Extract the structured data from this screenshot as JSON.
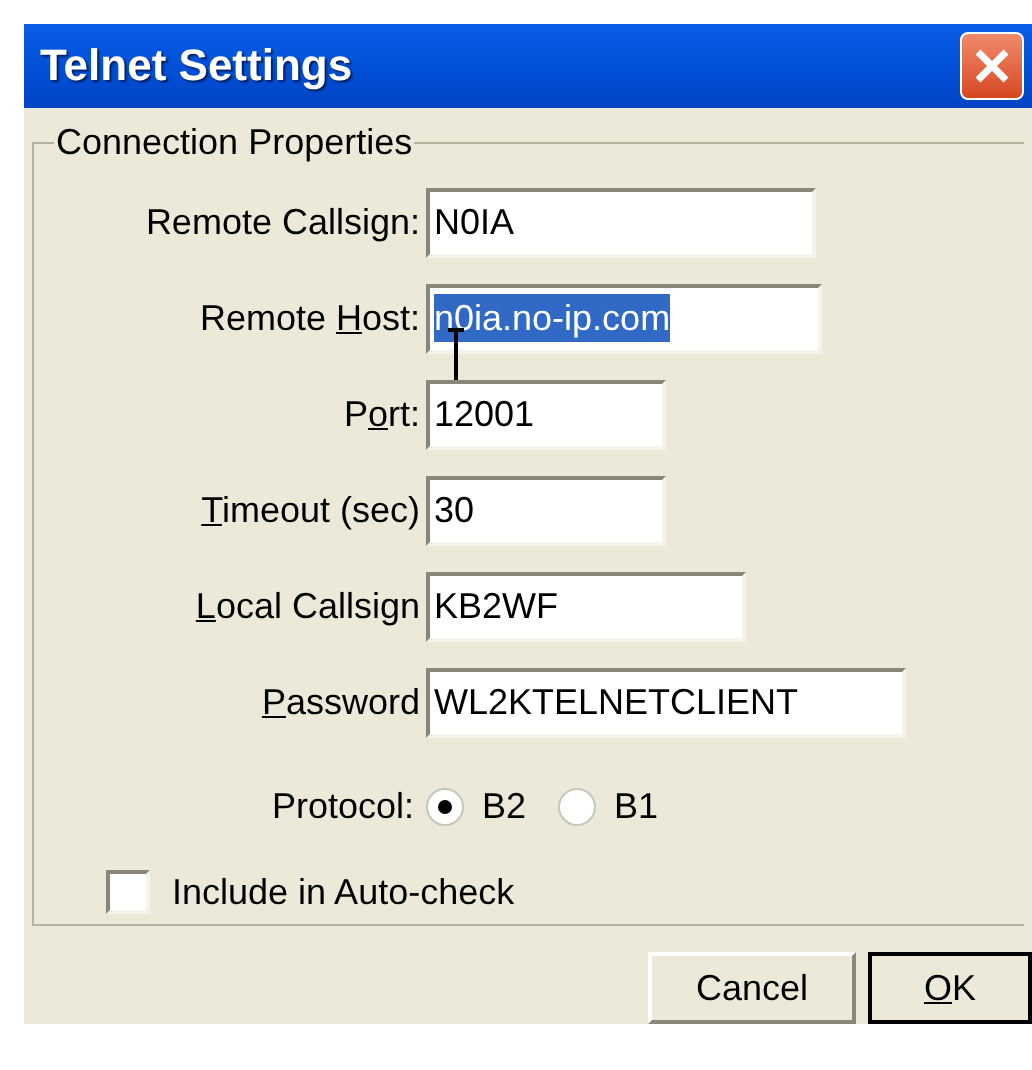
{
  "window": {
    "title": "Telnet Settings"
  },
  "group": {
    "legend": "Connection Properties"
  },
  "fields": [
    {
      "label_before": "Remote Callsign:",
      "value": "N0IA",
      "text_selected": false
    },
    {
      "label_before": "Remote ",
      "mnemonic": "H",
      "label_after": "ost:",
      "value": "n0ia.no-ip.com",
      "text_selected": true
    },
    {
      "label_before": "P",
      "mnemonic": "o",
      "label_after": "rt:",
      "value": "12001",
      "text_selected": false
    },
    {
      "mnemonic": "T",
      "label_after": "imeout (sec)",
      "value": "30",
      "text_selected": false
    },
    {
      "mnemonic": "L",
      "label_after": "ocal Callsign",
      "value": "KB2WF",
      "text_selected": false
    },
    {
      "mnemonic": "P",
      "label_after": "assword",
      "value": "WL2KTELNETCLIENT",
      "text_selected": false
    }
  ],
  "protocol": {
    "label": "Protocol:",
    "options": [
      {
        "label": "B2",
        "selected": true
      },
      {
        "label": "B1",
        "selected": false
      }
    ]
  },
  "auto_check": {
    "label": "Include in Auto-check",
    "checked": false
  },
  "buttons": [
    {
      "label_before": "Cancel",
      "default": false
    },
    {
      "mnemonic": "O",
      "label_after": "K",
      "default": true
    }
  ]
}
